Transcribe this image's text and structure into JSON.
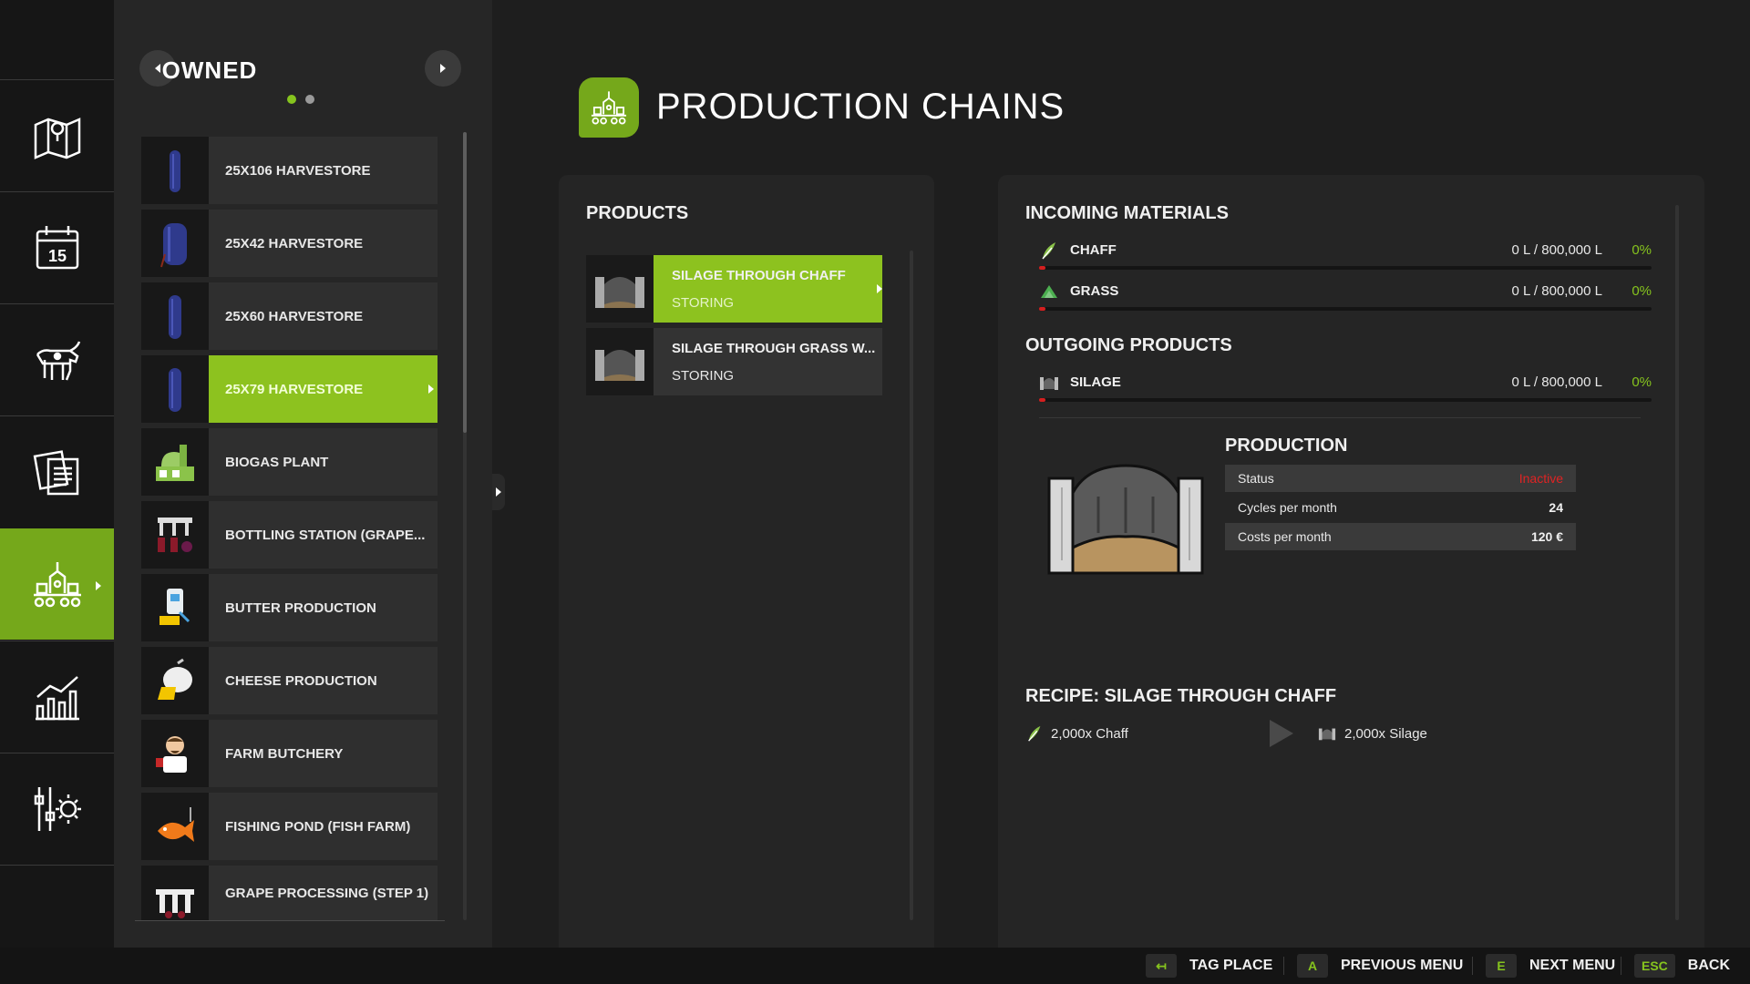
{
  "nav": {
    "items": [
      {
        "id": "map",
        "icon": "map-icon"
      },
      {
        "id": "calendar",
        "icon": "calendar-icon",
        "calendar_day": "15"
      },
      {
        "id": "animals",
        "icon": "cow-icon"
      },
      {
        "id": "contracts",
        "icon": "documents-icon"
      },
      {
        "id": "production",
        "icon": "production-icon",
        "active": true
      },
      {
        "id": "statistics",
        "icon": "chart-icon"
      },
      {
        "id": "settings",
        "icon": "settings-icon"
      }
    ]
  },
  "list": {
    "title": "OWNED",
    "page_indicator": {
      "pages": 2,
      "current": 1
    },
    "items": [
      {
        "label": "25X106 HARVESTORE",
        "icon": "silo-tall-icon"
      },
      {
        "label": "25X42 HARVESTORE",
        "icon": "silo-short-icon"
      },
      {
        "label": "25X60 HARVESTORE",
        "icon": "silo-tall-icon"
      },
      {
        "label": "25X79 HARVESTORE",
        "icon": "silo-tall-icon",
        "selected": true
      },
      {
        "label": "BIOGAS PLANT",
        "icon": "biogas-plant-icon"
      },
      {
        "label": "BOTTLING STATION (GRAPE...",
        "icon": "bottling-station-icon"
      },
      {
        "label": "BUTTER PRODUCTION",
        "icon": "butter-production-icon"
      },
      {
        "label": "CHEESE PRODUCTION",
        "icon": "cheese-production-icon"
      },
      {
        "label": "FARM BUTCHERY",
        "icon": "butcher-icon"
      },
      {
        "label": "FISHING POND (FISH FARM)",
        "icon": "fish-icon"
      },
      {
        "label": "GRAPE PROCESSING (STEP 1)",
        "icon": "grape-processing-icon"
      }
    ]
  },
  "header": {
    "title": "PRODUCTION CHAINS",
    "icon": "production-icon"
  },
  "products": {
    "title": "PRODUCTS",
    "items": [
      {
        "name": "SILAGE THROUGH CHAFF",
        "state": "STORING",
        "icon": "bunker-silo-icon",
        "selected": true
      },
      {
        "name": "SILAGE THROUGH GRASS W...",
        "state": "STORING",
        "icon": "bunker-silo-icon"
      }
    ]
  },
  "details": {
    "incoming_title": "INCOMING MATERIALS",
    "incoming": [
      {
        "name": "CHAFF",
        "amount": "0 L / 800,000 L",
        "percent": "0%",
        "fill": 0.01,
        "icon": "chaff-icon"
      },
      {
        "name": "GRASS",
        "amount": "0 L / 800,000 L",
        "percent": "0%",
        "fill": 0.01,
        "icon": "grass-icon"
      }
    ],
    "outgoing_title": "OUTGOING PRODUCTS",
    "outgoing": [
      {
        "name": "SILAGE",
        "amount": "0 L / 800,000 L",
        "percent": "0%",
        "fill": 0.01,
        "icon": "silage-icon"
      }
    ],
    "production": {
      "title": "PRODUCTION",
      "stats": [
        {
          "key": "Status",
          "value": "Inactive",
          "value_color": "#e02323"
        },
        {
          "key": "Cycles per month",
          "value": "24"
        },
        {
          "key": "Costs per month",
          "value": "120 €"
        }
      ]
    },
    "recipe": {
      "title": "RECIPE: SILAGE THROUGH CHAFF",
      "input": "2,000x Chaff",
      "output": "2,000x Silage"
    }
  },
  "footer": {
    "hints": [
      {
        "key": "↤",
        "label": "TAG PLACE"
      },
      {
        "key": "A",
        "label": "PREVIOUS MENU"
      },
      {
        "key": "E",
        "label": "NEXT MENU"
      },
      {
        "key": "ESC",
        "label": "BACK"
      }
    ]
  },
  "colors": {
    "accent": "#8dc21f",
    "accent_dark": "#75a81b",
    "warning": "#e02323",
    "bar_low": "#d41f1f"
  }
}
